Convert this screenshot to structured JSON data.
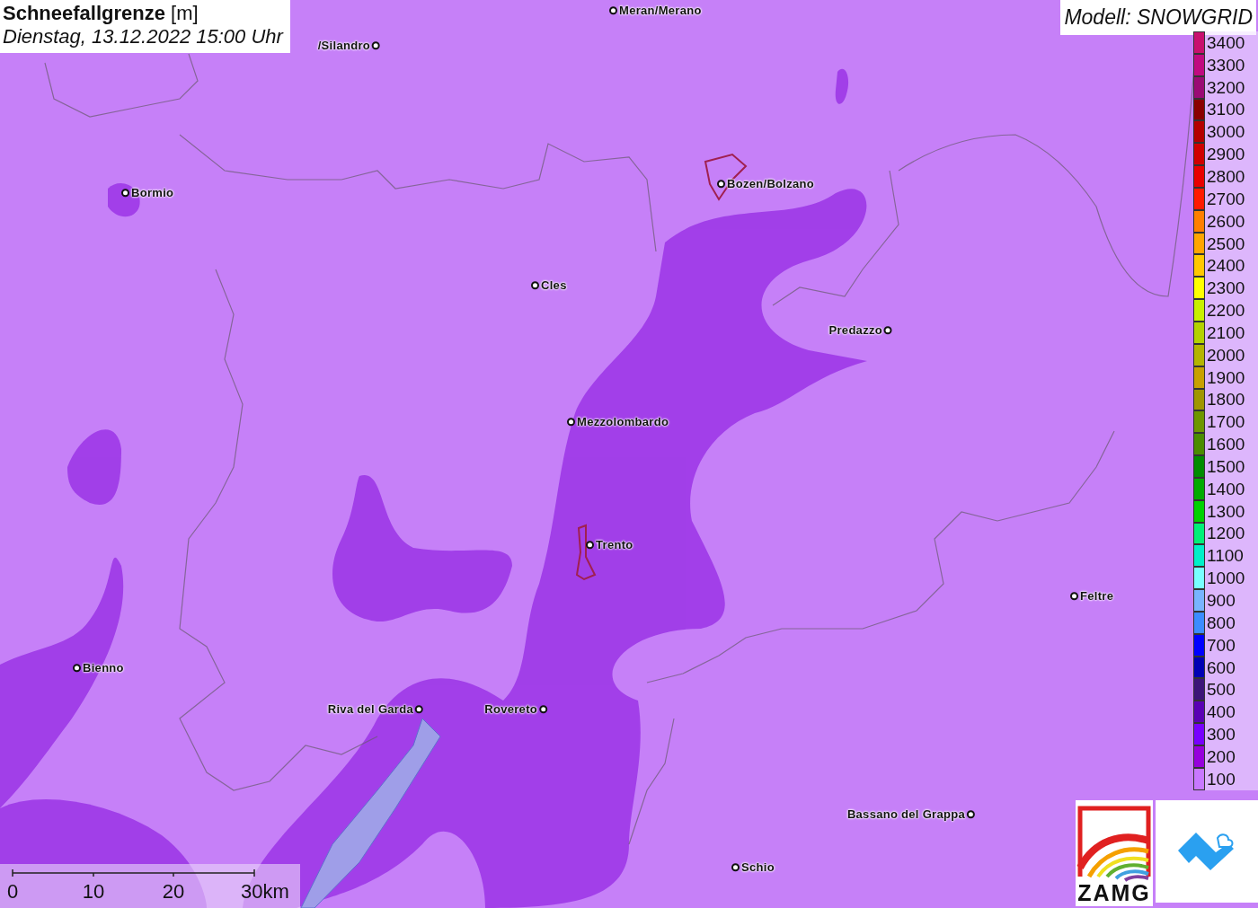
{
  "title": "**Schneefallgrenze** [m]",
  "subtitle": "Dienstag, 13.12.2022 15:00 Uhr",
  "model": "Modell: SNOWGRID",
  "cities": [
    {
      "label": "Meran/Merano"
    },
    {
      "label": "/Silandro"
    },
    {
      "label": "Bormio"
    },
    {
      "label": "Bozen/Bolzano"
    },
    {
      "label": "Cles"
    },
    {
      "label": "Predazzo"
    },
    {
      "label": "Mezzolombardo"
    },
    {
      "label": "Trento"
    },
    {
      "label": "Feltre"
    },
    {
      "label": "Bienno"
    },
    {
      "label": "Riva del Garda"
    },
    {
      "label": "Rovereto"
    },
    {
      "label": "Bassano del Grappa"
    },
    {
      "label": "Schio"
    }
  ],
  "legend": [
    {
      "label": "3400",
      "color": "#c8106e"
    },
    {
      "label": "3300",
      "color": "#c00a80"
    },
    {
      "label": "3200",
      "color": "#9a0a74"
    },
    {
      "label": "3100",
      "color": "#8a0000"
    },
    {
      "label": "3000",
      "color": "#b40000"
    },
    {
      "label": "2900",
      "color": "#d00000"
    },
    {
      "label": "2800",
      "color": "#e80000"
    },
    {
      "label": "2700",
      "color": "#ff1a00"
    },
    {
      "label": "2600",
      "color": "#ff7f00"
    },
    {
      "label": "2500",
      "color": "#ffa500"
    },
    {
      "label": "2400",
      "color": "#ffc800"
    },
    {
      "label": "2300",
      "color": "#ffff00"
    },
    {
      "label": "2200",
      "color": "#c8f000"
    },
    {
      "label": "2100",
      "color": "#b4d200"
    },
    {
      "label": "2000",
      "color": "#b4b400"
    },
    {
      "label": "1900",
      "color": "#c8a000"
    },
    {
      "label": "1800",
      "color": "#a09600"
    },
    {
      "label": "1700",
      "color": "#6e9600"
    },
    {
      "label": "1600",
      "color": "#4b8c00"
    },
    {
      "label": "1500",
      "color": "#008c00"
    },
    {
      "label": "1400",
      "color": "#00aa00"
    },
    {
      "label": "1300",
      "color": "#00d200"
    },
    {
      "label": "1200",
      "color": "#00f078"
    },
    {
      "label": "1100",
      "color": "#00f0c8"
    },
    {
      "label": "1000",
      "color": "#78ffff"
    },
    {
      "label": "900",
      "color": "#78b4ff"
    },
    {
      "label": "800",
      "color": "#3c8cff"
    },
    {
      "label": "700",
      "color": "#0000ff"
    },
    {
      "label": "600",
      "color": "#0000b4"
    },
    {
      "label": "500",
      "color": "#3c1478"
    },
    {
      "label": "400",
      "color": "#5a00b4"
    },
    {
      "label": "300",
      "color": "#7800ff"
    },
    {
      "label": "200",
      "color": "#9600dc"
    },
    {
      "label": "100",
      "color": "#c878ff"
    }
  ],
  "scale": [
    "0",
    "10",
    "20",
    "30km"
  ],
  "logo_text": "ZAMG"
}
